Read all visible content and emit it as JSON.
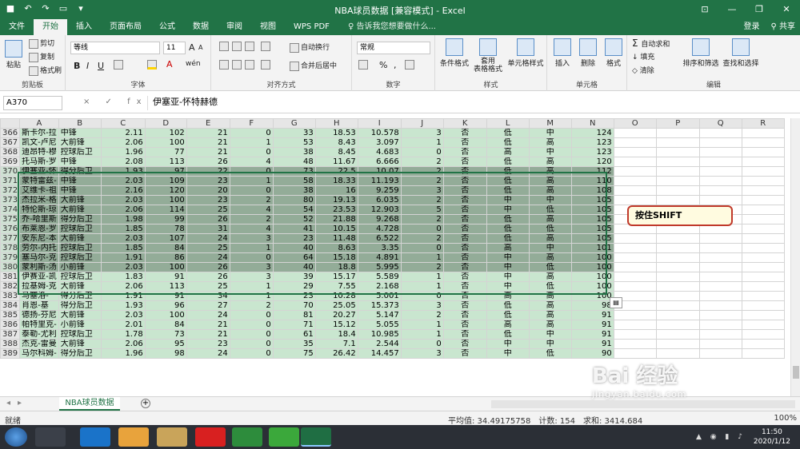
{
  "window": {
    "title": "NBA球员数据  [兼容模式] - Excel",
    "buttons": [
      "⊡",
      "—",
      "❐",
      "✕"
    ]
  },
  "qat_icons": [
    "save-icon",
    "undo-icon",
    "redo-icon",
    "folder-icon",
    "customize-icon"
  ],
  "tabs": [
    "文件",
    "开始",
    "插入",
    "页面布局",
    "公式",
    "数据",
    "审阅",
    "视图",
    "WPS PDF"
  ],
  "active_tab": "开始",
  "tell_me": "告诉我您想要做什么...",
  "account": {
    "signin": "登录",
    "share": "共享"
  },
  "ribbon": {
    "clipboard": {
      "label": "剪贴板",
      "paste": "粘贴",
      "cut": "剪切",
      "copy": "复制",
      "format_painter": "格式刷"
    },
    "font": {
      "label": "字体",
      "font_name": "等线",
      "font_size": "11",
      "bold": "B",
      "italic": "I",
      "underline": "U",
      "grow": "A",
      "shrink": "A",
      "wen": "wén"
    },
    "align": {
      "label": "对齐方式",
      "wrap": "自动换行",
      "merge": "合并后居中"
    },
    "number": {
      "label": "数字",
      "format": "常规",
      "percent": "%",
      "comma": ","
    },
    "styles": {
      "label": "样式",
      "cond": "条件格式",
      "table": "套用\n表格格式",
      "cell": "单元格样式"
    },
    "cells": {
      "label": "单元格",
      "insert": "插入",
      "delete": "删除",
      "format": "格式"
    },
    "editing": {
      "label": "编辑",
      "autosum": "自动求和",
      "fill": "填充",
      "clear": "清除",
      "sort": "排序和筛选",
      "find": "查找和选择"
    }
  },
  "formula_bar": {
    "name_box": "A370",
    "fx": "× ✓ fx",
    "value": "伊塞亚-怀特赫德"
  },
  "columns": [
    "A",
    "B",
    "C",
    "D",
    "E",
    "F",
    "G",
    "H",
    "I",
    "J",
    "K",
    "L",
    "M",
    "N",
    "O",
    "P",
    "Q",
    "R"
  ],
  "rows": [
    {
      "n": "366",
      "a": "斯卡尔-拉",
      "b": "中锋",
      "c": "2.11",
      "d": "102",
      "e": "21",
      "f": "0",
      "g": "33",
      "h": "18.53",
      "i": "10.578",
      "j": "3",
      "k": "否",
      "l": "低",
      "m": "中",
      "nn": "124"
    },
    {
      "n": "367",
      "a": "凯文-卢尼",
      "b": "大前锋",
      "c": "2.06",
      "d": "100",
      "e": "21",
      "f": "1",
      "g": "53",
      "h": "8.43",
      "i": "3.097",
      "j": "1",
      "k": "否",
      "l": "低",
      "m": "高",
      "nn": "123"
    },
    {
      "n": "368",
      "a": "迪昂特-穆",
      "b": "控球后卫",
      "c": "1.96",
      "d": "77",
      "e": "21",
      "f": "0",
      "g": "38",
      "h": "8.45",
      "i": "4.683",
      "j": "0",
      "k": "否",
      "l": "高",
      "m": "中",
      "nn": "123"
    },
    {
      "n": "369",
      "a": "托马斯-罗",
      "b": "中锋",
      "c": "2.08",
      "d": "113",
      "e": "26",
      "f": "4",
      "g": "48",
      "h": "11.67",
      "i": "6.666",
      "j": "2",
      "k": "否",
      "l": "低",
      "m": "高",
      "nn": "120"
    },
    {
      "n": "370",
      "a": "伊塞亚-怀",
      "b": "得分后卫",
      "c": "1.93",
      "d": "97",
      "e": "22",
      "f": "0",
      "g": "73",
      "h": "22.5",
      "i": "10.07",
      "j": "2",
      "k": "否",
      "l": "低",
      "m": "高",
      "nn": "112"
    },
    {
      "n": "371",
      "a": "蒙特雷兹-",
      "b": "中锋",
      "c": "2.03",
      "d": "109",
      "e": "23",
      "f": "1",
      "g": "58",
      "h": "18.33",
      "i": "11.193",
      "j": "2",
      "k": "否",
      "l": "低",
      "m": "高",
      "nn": "110"
    },
    {
      "n": "372",
      "a": "艾维卡-祖",
      "b": "中锋",
      "c": "2.16",
      "d": "120",
      "e": "20",
      "f": "0",
      "g": "38",
      "h": "16",
      "i": "9.259",
      "j": "3",
      "k": "否",
      "l": "低",
      "m": "高",
      "nn": "108"
    },
    {
      "n": "373",
      "a": "杰拉米-格",
      "b": "大前锋",
      "c": "2.03",
      "d": "100",
      "e": "23",
      "f": "2",
      "g": "80",
      "h": "19.13",
      "i": "6.035",
      "j": "2",
      "k": "否",
      "l": "中",
      "m": "中",
      "nn": "105"
    },
    {
      "n": "374",
      "a": "特伦斯-琼",
      "b": "大前锋",
      "c": "2.06",
      "d": "114",
      "e": "25",
      "f": "4",
      "g": "54",
      "h": "23.53",
      "i": "12.903",
      "j": "5",
      "k": "否",
      "l": "中",
      "m": "低",
      "nn": "105"
    },
    {
      "n": "375",
      "a": "乔-哈里斯",
      "b": "得分后卫",
      "c": "1.98",
      "d": "99",
      "e": "26",
      "f": "2",
      "g": "52",
      "h": "21.88",
      "i": "9.268",
      "j": "2",
      "k": "否",
      "l": "低",
      "m": "高",
      "nn": "105"
    },
    {
      "n": "376",
      "a": "布莱恩-罗",
      "b": "控球后卫",
      "c": "1.85",
      "d": "78",
      "e": "31",
      "f": "4",
      "g": "41",
      "h": "10.15",
      "i": "4.728",
      "j": "0",
      "k": "否",
      "l": "低",
      "m": "低",
      "nn": "105"
    },
    {
      "n": "377",
      "a": "安东尼-本",
      "b": "大前锋",
      "c": "2.03",
      "d": "107",
      "e": "24",
      "f": "3",
      "g": "23",
      "h": "11.48",
      "i": "6.522",
      "j": "2",
      "k": "否",
      "l": "低",
      "m": "高",
      "nn": "105"
    },
    {
      "n": "378",
      "a": "劳尔-内托",
      "b": "控球后卫",
      "c": "1.85",
      "d": "84",
      "e": "25",
      "f": "1",
      "g": "40",
      "h": "8.63",
      "i": "3.35",
      "j": "0",
      "k": "否",
      "l": "高",
      "m": "中",
      "nn": "101"
    },
    {
      "n": "379",
      "a": "塞马尔-克",
      "b": "控球后卫",
      "c": "1.91",
      "d": "86",
      "e": "24",
      "f": "0",
      "g": "64",
      "h": "15.18",
      "i": "4.891",
      "j": "1",
      "k": "否",
      "l": "中",
      "m": "高",
      "nn": "100"
    },
    {
      "n": "380",
      "a": "蒙利斯-汤",
      "b": "小前锋",
      "c": "2.03",
      "d": "100",
      "e": "26",
      "f": "3",
      "g": "40",
      "h": "18.8",
      "i": "5.995",
      "j": "2",
      "k": "否",
      "l": "中",
      "m": "低",
      "nn": "100"
    },
    {
      "n": "381",
      "a": "伊赛亚-凯",
      "b": "控球后卫",
      "c": "1.83",
      "d": "91",
      "e": "26",
      "f": "3",
      "g": "39",
      "h": "15.17",
      "i": "5.589",
      "j": "1",
      "k": "否",
      "l": "中",
      "m": "高",
      "nn": "100"
    },
    {
      "n": "382",
      "a": "拉基姆-克",
      "b": "大前锋",
      "c": "2.06",
      "d": "113",
      "e": "25",
      "f": "1",
      "g": "29",
      "h": "7.55",
      "i": "2.168",
      "j": "1",
      "k": "否",
      "l": "中",
      "m": "低",
      "nn": "100"
    },
    {
      "n": "383",
      "a": "马塞洛-",
      "b": "得分后卫",
      "c": "1.91",
      "d": "91",
      "e": "34",
      "f": "1",
      "g": "23",
      "h": "10.28",
      "i": "5.001",
      "j": "0",
      "k": "否",
      "l": "高",
      "m": "高",
      "nn": "100"
    },
    {
      "n": "384",
      "a": "肖恩-基",
      "b": "得分后卫",
      "c": "1.93",
      "d": "96",
      "e": "27",
      "f": "2",
      "g": "70",
      "h": "25.05",
      "i": "15.373",
      "j": "3",
      "k": "否",
      "l": "低",
      "m": "高",
      "nn": "98"
    },
    {
      "n": "385",
      "a": "德扬-芬尼",
      "b": "大前锋",
      "c": "2.03",
      "d": "100",
      "e": "24",
      "f": "0",
      "g": "81",
      "h": "20.27",
      "i": "5.147",
      "j": "2",
      "k": "否",
      "l": "低",
      "m": "高",
      "nn": "91"
    },
    {
      "n": "386",
      "a": "帕特里克-",
      "b": "小前锋",
      "c": "2.01",
      "d": "84",
      "e": "21",
      "f": "0",
      "g": "71",
      "h": "15.12",
      "i": "5.055",
      "j": "1",
      "k": "否",
      "l": "高",
      "m": "高",
      "nn": "91"
    },
    {
      "n": "387",
      "a": "泰勒-尤利",
      "b": "控球后卫",
      "c": "1.78",
      "d": "73",
      "e": "21",
      "f": "0",
      "g": "61",
      "h": "18.4",
      "i": "10.985",
      "j": "1",
      "k": "否",
      "l": "低",
      "m": "中",
      "nn": "91"
    },
    {
      "n": "388",
      "a": "杰克-雷曼",
      "b": "大前锋",
      "c": "2.06",
      "d": "95",
      "e": "23",
      "f": "0",
      "g": "35",
      "h": "7.1",
      "i": "2.544",
      "j": "0",
      "k": "否",
      "l": "中",
      "m": "中",
      "nn": "91"
    },
    {
      "n": "389",
      "a": "马尔科姆-",
      "b": "得分后卫",
      "c": "1.96",
      "d": "98",
      "e": "24",
      "f": "0",
      "g": "75",
      "h": "26.42",
      "i": "14.457",
      "j": "3",
      "k": "否",
      "l": "中",
      "m": "低",
      "nn": "90"
    }
  ],
  "callout": "按住SHIFT",
  "sheet_tab": "NBA球员数据",
  "status": {
    "ready": "就绪",
    "average": "平均值: 34.49175758",
    "count": "计数: 154",
    "sum": "求和: 3414.684",
    "zoom": "100%"
  },
  "clock": {
    "time": "11:50",
    "date": "2020/1/12"
  },
  "watermark": {
    "brand": "Bai 经验",
    "url": "jingyan.baidu.com"
  }
}
